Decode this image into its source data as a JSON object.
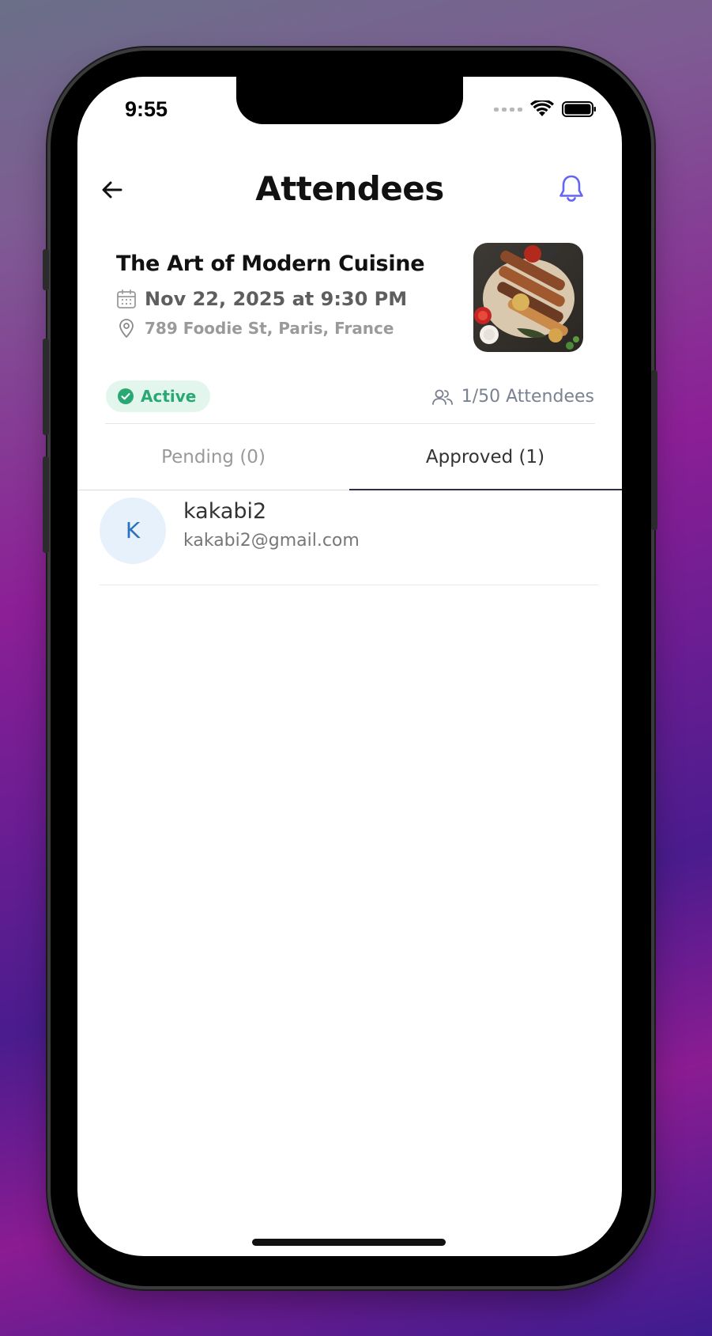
{
  "status_bar": {
    "time": "9:55",
    "icons": [
      "signal-dots-icon",
      "wifi-icon",
      "battery-icon"
    ]
  },
  "header": {
    "title": "Attendees",
    "back_icon": "arrow-left-icon",
    "notification_icon": "bell-icon",
    "accent_color": "#6366f1"
  },
  "event": {
    "title": "The Art of Modern Cuisine",
    "date": "Nov 22, 2025 at 9:30 PM",
    "location": "789 Foodie St, Paris, France",
    "image_icon": "food-photo"
  },
  "status": {
    "label": "Active",
    "color": "#2aa874"
  },
  "attendance": {
    "text": "1/50 Attendees"
  },
  "tabs": [
    {
      "label": "Pending (0)",
      "selected": false
    },
    {
      "label": "Approved (1)",
      "selected": true
    }
  ],
  "attendees": [
    {
      "initial": "K",
      "name": "kakabi2",
      "email": "kakabi2@gmail.com"
    }
  ]
}
